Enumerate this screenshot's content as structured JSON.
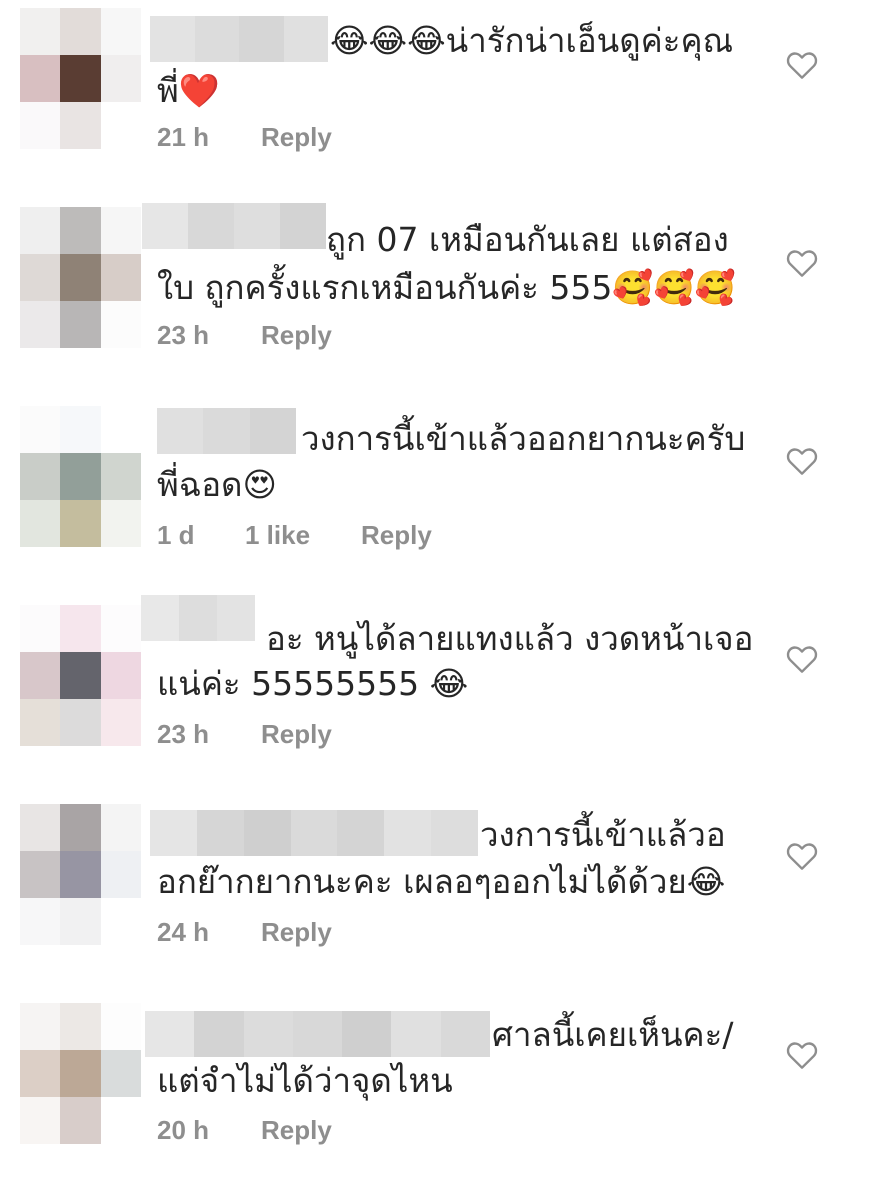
{
  "comments": [
    {
      "line1": "😂😂😂น่ารักน่าเอ็นดูค่ะคุณ",
      "line2": "พี่❤️",
      "time": "21 h",
      "likes": "",
      "reply": "Reply"
    },
    {
      "line1": "ถูก 07 เหมือนกันเลย แต่สอง",
      "line2": "ใบ ถูกครั้งแรกเหมือนกันค่ะ 555🥰🥰🥰",
      "time": "23 h",
      "likes": "",
      "reply": "Reply"
    },
    {
      "line1": "วงการนี้เข้าแล้วออกยากนะครับ",
      "line2": "พี่ฉอด😍",
      "time": "1 d",
      "likes": "1 like",
      "reply": "Reply"
    },
    {
      "line1": "อะ หนูได้ลายแทงแล้ว งวดหน้าเจอ",
      "line2": "แน่ค่ะ 55555555 😂",
      "time": "23 h",
      "likes": "",
      "reply": "Reply"
    },
    {
      "line1": "วงการนี้เข้าแล้วอ",
      "line2": "อกย๊ากยากนะคะ เผลอๆออกไม่ได้ด้วย😂",
      "time": "24 h",
      "likes": "",
      "reply": "Reply"
    },
    {
      "line1": "ศาลนี้เคยเห็นคะ/",
      "line2": "แต่จำไม่ได้ว่าจุดไหน",
      "time": "20 h",
      "likes": "",
      "reply": "Reply"
    }
  ],
  "colors": {
    "text": "#262626",
    "meta": "#8e8e8e",
    "blur": "#d9d9d9"
  },
  "icons": {
    "like": "heart-outline-icon"
  }
}
